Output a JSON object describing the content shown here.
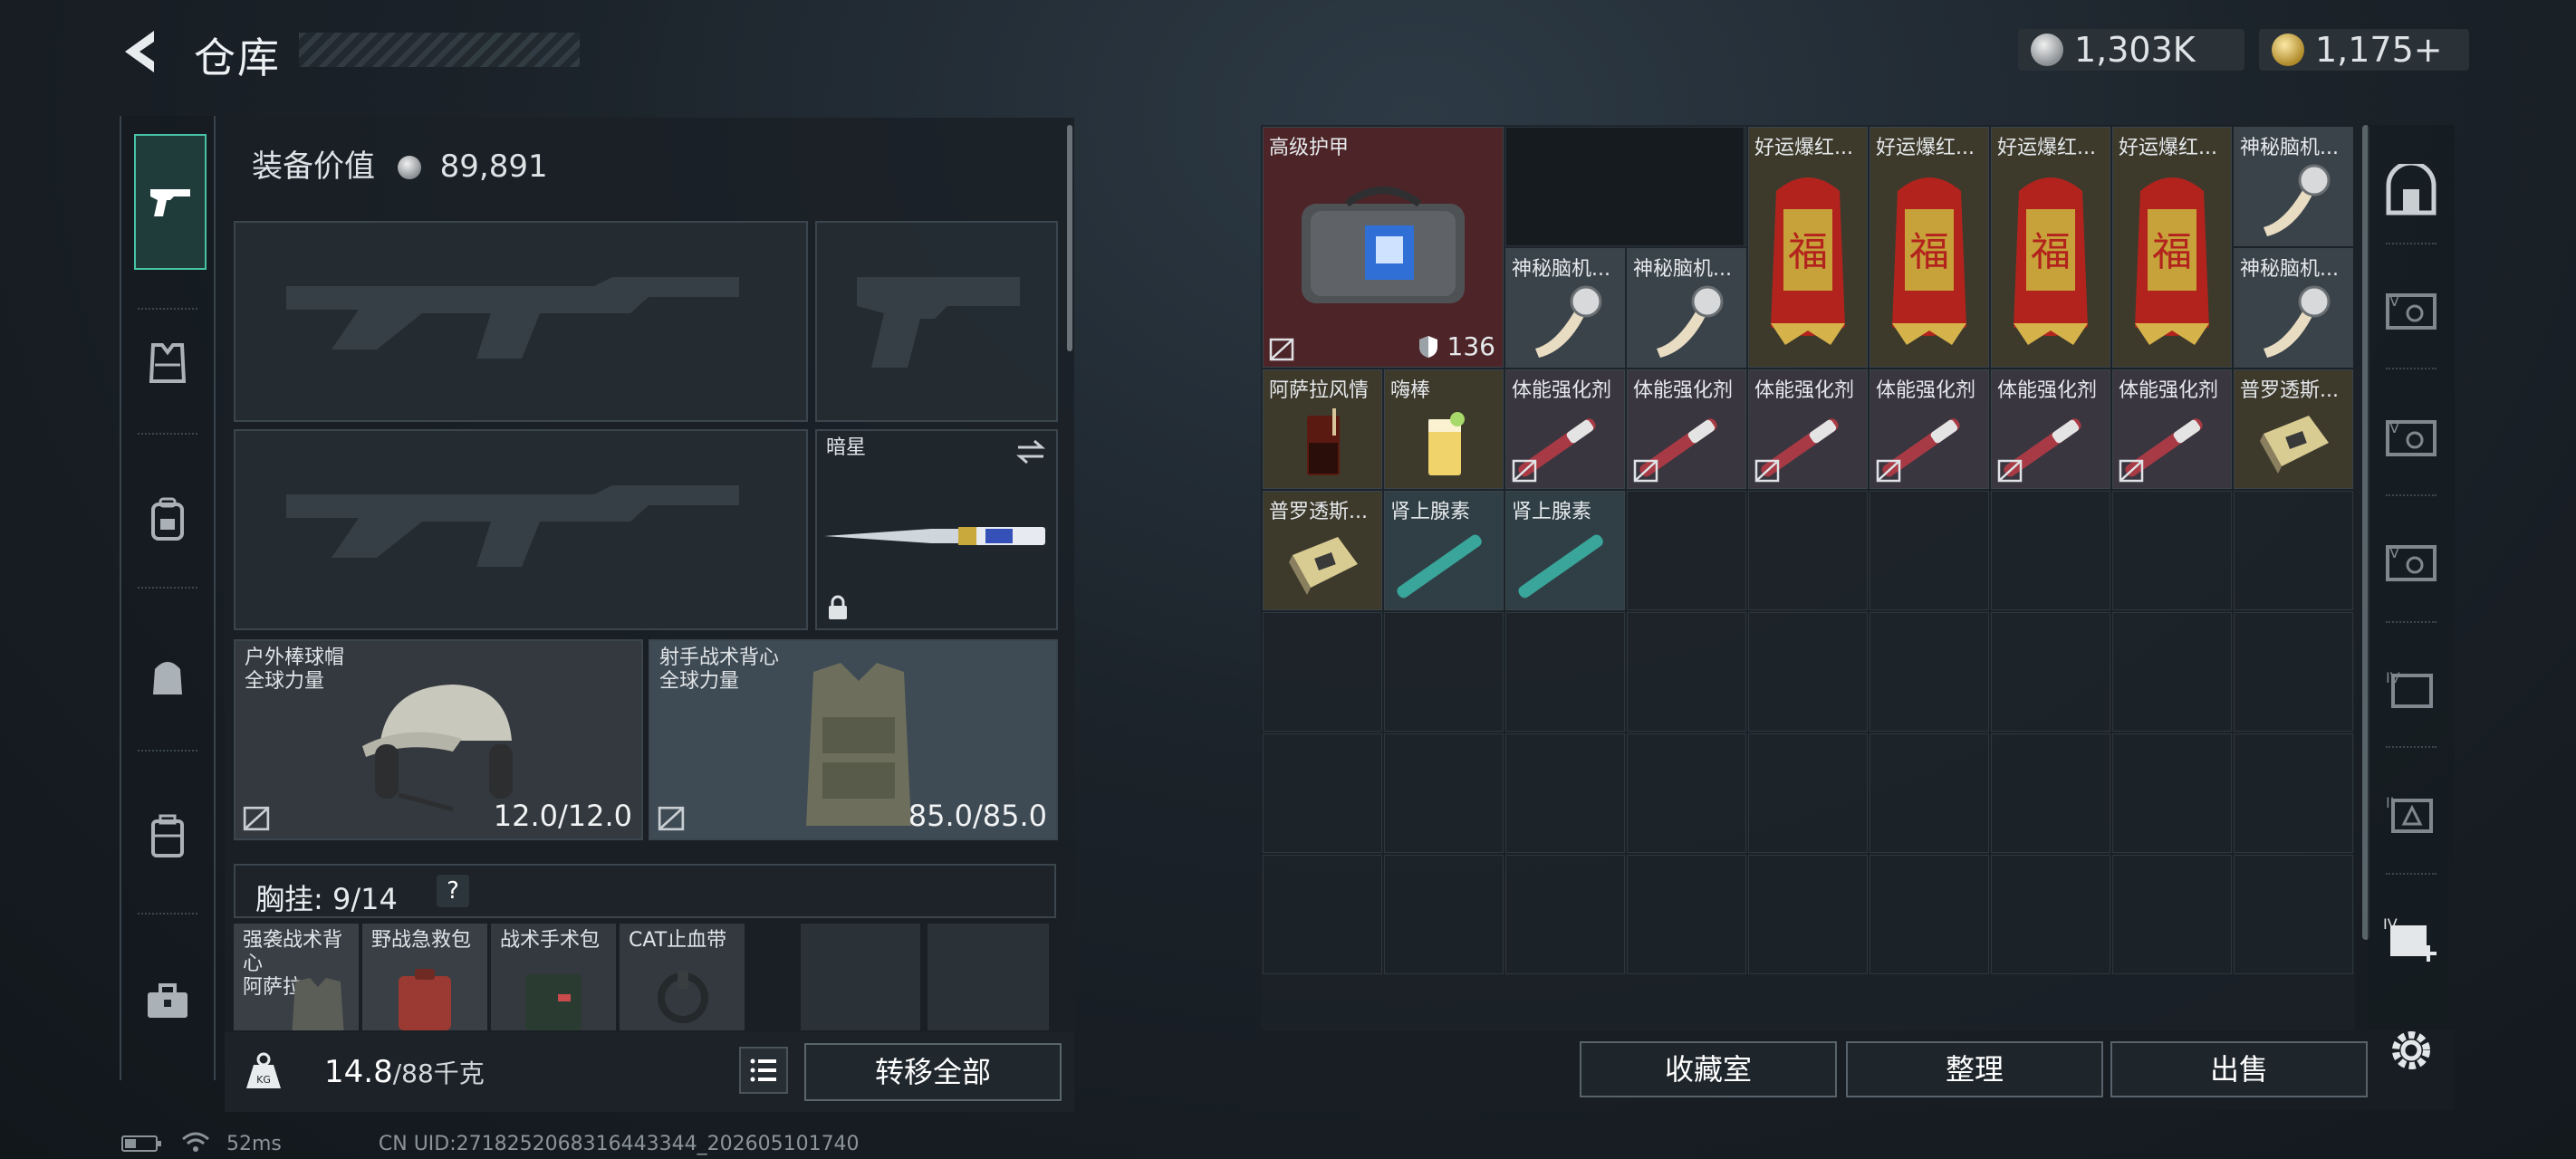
{
  "header": {
    "title": "仓库"
  },
  "currency": {
    "silver": "1,303K",
    "gold": "1,175+"
  },
  "loadout": {
    "equip_value_label": "装备价值",
    "equip_value": "89,891",
    "melee_name": "暗星",
    "helmet": {
      "name": "户外棒球帽",
      "sub": "全球力量",
      "durability": "12.0/12.0"
    },
    "vest": {
      "name": "射手战术背心",
      "sub": "全球力量",
      "durability": "85.0/85.0"
    },
    "chest_rig": "胸挂: 9/14",
    "chest_help": "?",
    "small_items": [
      {
        "name": "强袭战术背心",
        "sub": "阿萨拉"
      },
      {
        "name": "野战急救包"
      },
      {
        "name": "战术手术包"
      },
      {
        "name": "CAT止血带"
      }
    ],
    "weight": "14.8",
    "weight_cap": "/88千克",
    "transfer_all": "转移全部"
  },
  "stash": {
    "items": [
      {
        "name": "高级护甲",
        "armor": "136"
      },
      {
        "name": "神秘脑机..."
      },
      {
        "name": "神秘脑机..."
      },
      {
        "name": "好运爆红..."
      },
      {
        "name": "好运爆红..."
      },
      {
        "name": "好运爆红..."
      },
      {
        "name": "好运爆红..."
      },
      {
        "name": "神秘脑机..."
      },
      {
        "name": "神秘脑机..."
      },
      {
        "name": "阿萨拉风情"
      },
      {
        "name": "嗨棒"
      },
      {
        "name": "体能强化剂"
      },
      {
        "name": "体能强化剂"
      },
      {
        "name": "体能强化剂"
      },
      {
        "name": "体能强化剂"
      },
      {
        "name": "体能强化剂"
      },
      {
        "name": "体能强化剂"
      },
      {
        "name": "普罗透斯..."
      },
      {
        "name": "普罗透斯..."
      },
      {
        "name": "肾上腺素"
      },
      {
        "name": "肾上腺素"
      }
    ]
  },
  "buttons": {
    "collection": "收藏室",
    "sort": "整理",
    "sell": "出售"
  },
  "status": {
    "ping": "52ms",
    "uid": "CN UID:2718252068316443344_202605101740"
  },
  "colors": {
    "accent": "#48c2a5",
    "armor_bg": "#5a2a2f",
    "firework_red": "#b3231d"
  }
}
